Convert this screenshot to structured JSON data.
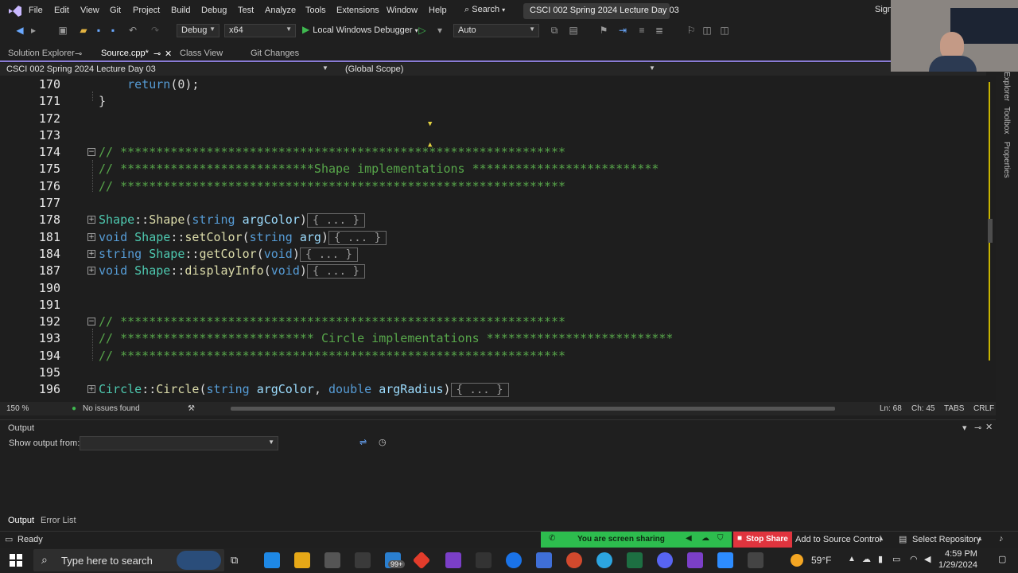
{
  "menubar": {
    "items": [
      "File",
      "Edit",
      "View",
      "Git",
      "Project",
      "Build",
      "Debug",
      "Test",
      "Analyze",
      "Tools",
      "Extensions",
      "Window",
      "Help"
    ],
    "search_label": "Search",
    "window_title": "CSCI 002 Spring 2024 Lecture Day 03",
    "sign_in": "Sign"
  },
  "toolbar": {
    "config": "Debug",
    "platform": "x64",
    "run_label": "Local Windows Debugger",
    "auto": "Auto"
  },
  "tabs": {
    "solution_explorer": "Solution Explorer",
    "source": "Source.cpp*",
    "class_view": "Class View",
    "git_changes": "Git Changes"
  },
  "navbar": {
    "project": "CSCI 002 Spring 2024 Lecture Day 03",
    "scope": "(Global Scope)"
  },
  "editor": {
    "lines": [
      {
        "num": "170",
        "text": "    return(0);"
      },
      {
        "num": "171",
        "text": "}"
      },
      {
        "num": "172",
        "text": ""
      },
      {
        "num": "173",
        "text": ""
      },
      {
        "num": "174",
        "text": "// **************************************************************"
      },
      {
        "num": "175",
        "text": "// ***************************Shape implementations **************************"
      },
      {
        "num": "176",
        "text": "// **************************************************************"
      },
      {
        "num": "177",
        "text": ""
      },
      {
        "num": "178",
        "text": "Shape::Shape(string argColor)",
        "collapsed": "{ ... }"
      },
      {
        "num": "181",
        "text": "void Shape::setColor(string arg)",
        "collapsed": "{ ... }"
      },
      {
        "num": "184",
        "text": "string Shape::getColor(void)",
        "collapsed": "{ ... }"
      },
      {
        "num": "187",
        "text": "void Shape::displayInfo(void)",
        "collapsed": "{ ... }"
      },
      {
        "num": "190",
        "text": ""
      },
      {
        "num": "191",
        "text": ""
      },
      {
        "num": "192",
        "text": "// **************************************************************"
      },
      {
        "num": "193",
        "text": "// *************************** Circle implementations **************************"
      },
      {
        "num": "194",
        "text": "// **************************************************************"
      },
      {
        "num": "195",
        "text": ""
      },
      {
        "num": "196",
        "text": "Circle::Circle(string argColor, double argRadius)",
        "collapsed": "{ ... }"
      }
    ]
  },
  "right_panel": [
    "Explorer",
    "Toolbox",
    "Properties"
  ],
  "editor_status": {
    "zoom": "150 %",
    "issues": "No issues found",
    "line": "Ln: 68",
    "col": "Ch: 45",
    "tabs": "TABS",
    "eol": "CRLF"
  },
  "output_panel": {
    "title": "Output",
    "show_from": "Show output from:"
  },
  "bottom_tabs": [
    "Output",
    "Error List"
  ],
  "status_bar": {
    "ready": "Ready",
    "sharing": "You are screen sharing",
    "stop_share": "Stop Share",
    "source_control": "Add to Source Control",
    "repository": "Select Repository"
  },
  "taskbar": {
    "search_placeholder": "Type here to search",
    "badge": "99+",
    "weather": "59°F",
    "time": "4:59 PM",
    "date": "1/29/2024"
  }
}
